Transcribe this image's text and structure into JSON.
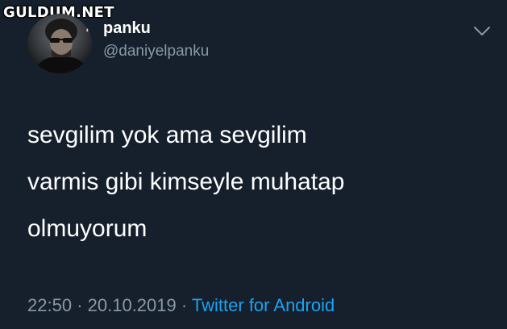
{
  "watermark": "GULDUM.NET",
  "tweet": {
    "display_name": "panku",
    "handle": "@daniyelpanku",
    "text_lines": [
      "sevgilim yok ama sevgilim",
      "varmis gibi kimseyle muhatap",
      "olmuyorum"
    ],
    "time": "22:50",
    "separator": "·",
    "date": "20.10.2019",
    "source": "Twitter for Android"
  },
  "icons": {
    "menu": "chevron-down-icon",
    "avatar": "profile-photo"
  },
  "colors": {
    "background": "#16202c",
    "text_primary": "#ffffff",
    "text_secondary": "#8899a6",
    "link": "#1da1f2"
  }
}
